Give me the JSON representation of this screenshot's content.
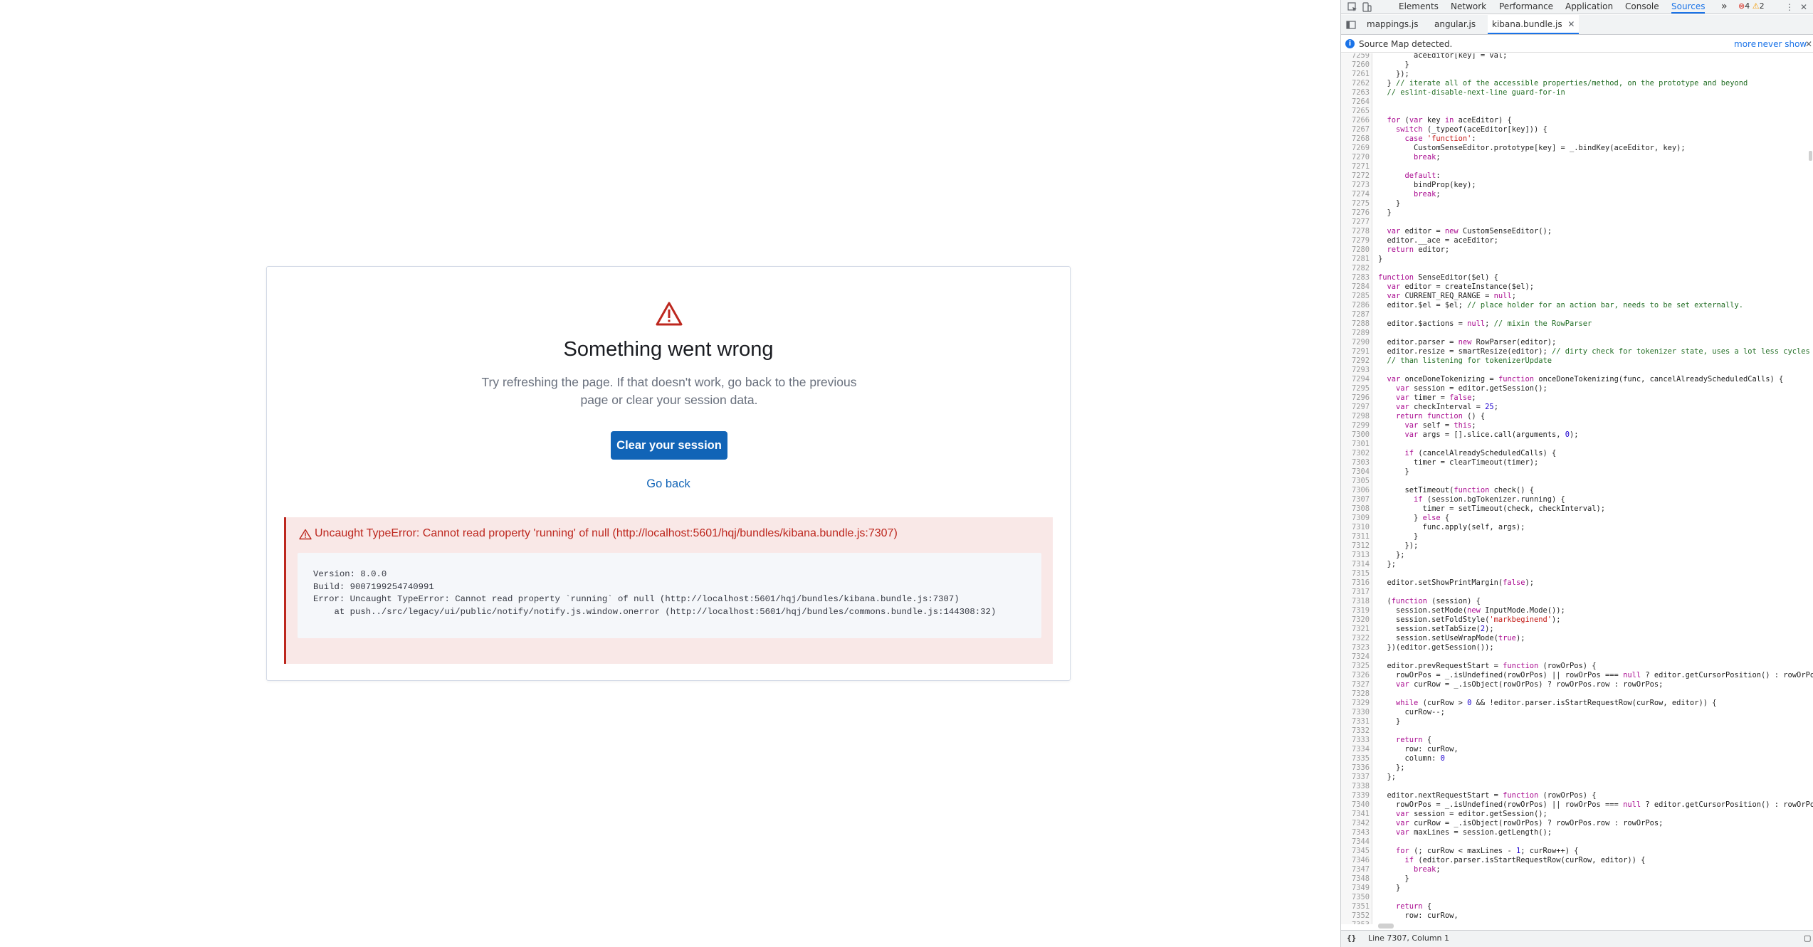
{
  "app": {
    "title": "Something went wrong",
    "body": "Try refreshing the page. If that doesn't work, go back to the previous page or clear your session data.",
    "clear_button": "Clear your session",
    "go_back": "Go back",
    "error_title": "Uncaught TypeError: Cannot read property 'running' of null (http://localhost:5601/hqj/bundles/kibana.bundle.js:7307)",
    "error_details": "Version: 8.0.0\nBuild: 9007199254740991\nError: Uncaught TypeError: Cannot read property `running` of null (http://localhost:5601/hqj/bundles/kibana.bundle.js:7307)\n    at push../src/legacy/ui/public/notify/notify.js.window.onerror (http://localhost:5601/hqj/bundles/commons.bundle.js:144308:32)"
  },
  "devtools": {
    "tabs": [
      {
        "label": "Elements",
        "active": false
      },
      {
        "label": "Network",
        "active": false
      },
      {
        "label": "Performance",
        "active": false
      },
      {
        "label": "Application",
        "active": false
      },
      {
        "label": "Console",
        "active": false
      },
      {
        "label": "Sources",
        "active": true
      }
    ],
    "more_tabs": "»",
    "error_count": "4",
    "warning_count": "2",
    "file_tabs": [
      {
        "label": "mappings.js",
        "active": false
      },
      {
        "label": "angular.js",
        "active": false
      },
      {
        "label": "kibana.bundle.js",
        "active": true
      }
    ],
    "sourcemap_text": "Source Map detected.",
    "sourcemap_more": "more",
    "sourcemap_never": "never show",
    "status": "Line 7307, Column 1",
    "code_lines": [
      {
        "n": "7259",
        "code": "        aceEditor[key] = val;"
      },
      {
        "n": "7260",
        "code": "      }"
      },
      {
        "n": "7261",
        "code": "    });"
      },
      {
        "n": "7262",
        "code": "  } // iterate all of the accessible properties/method, on the prototype and beyond"
      },
      {
        "n": "7263",
        "code": "  // eslint-disable-next-line guard-for-in"
      },
      {
        "n": "7264",
        "code": ""
      },
      {
        "n": "7265",
        "code": ""
      },
      {
        "n": "7266",
        "code": "  for (var key in aceEditor) {"
      },
      {
        "n": "7267",
        "code": "    switch (_typeof(aceEditor[key])) {"
      },
      {
        "n": "7268",
        "code": "      case 'function':"
      },
      {
        "n": "7269",
        "code": "        CustomSenseEditor.prototype[key] = _.bindKey(aceEditor, key);"
      },
      {
        "n": "7270",
        "code": "        break;"
      },
      {
        "n": "7271",
        "code": ""
      },
      {
        "n": "7272",
        "code": "      default:"
      },
      {
        "n": "7273",
        "code": "        bindProp(key);"
      },
      {
        "n": "7274",
        "code": "        break;"
      },
      {
        "n": "7275",
        "code": "    }"
      },
      {
        "n": "7276",
        "code": "  }"
      },
      {
        "n": "7277",
        "code": ""
      },
      {
        "n": "7278",
        "code": "  var editor = new CustomSenseEditor();"
      },
      {
        "n": "7279",
        "code": "  editor.__ace = aceEditor;"
      },
      {
        "n": "7280",
        "code": "  return editor;"
      },
      {
        "n": "7281",
        "code": "}"
      },
      {
        "n": "7282",
        "code": ""
      },
      {
        "n": "7283",
        "code": "function SenseEditor($el) {"
      },
      {
        "n": "7284",
        "code": "  var editor = createInstance($el);"
      },
      {
        "n": "7285",
        "code": "  var CURRENT_REQ_RANGE = null;"
      },
      {
        "n": "7286",
        "code": "  editor.$el = $el; // place holder for an action bar, needs to be set externally."
      },
      {
        "n": "7287",
        "code": ""
      },
      {
        "n": "7288",
        "code": "  editor.$actions = null; // mixin the RowParser"
      },
      {
        "n": "7289",
        "code": ""
      },
      {
        "n": "7290",
        "code": "  editor.parser = new RowParser(editor);"
      },
      {
        "n": "7291",
        "code": "  editor.resize = smartResize(editor); // dirty check for tokenizer state, uses a lot less cycles"
      },
      {
        "n": "7292",
        "code": "  // than listening for tokenizerUpdate"
      },
      {
        "n": "7293",
        "code": ""
      },
      {
        "n": "7294",
        "code": "  var onceDoneTokenizing = function onceDoneTokenizing(func, cancelAlreadyScheduledCalls) {"
      },
      {
        "n": "7295",
        "code": "    var session = editor.getSession();"
      },
      {
        "n": "7296",
        "code": "    var timer = false;"
      },
      {
        "n": "7297",
        "code": "    var checkInterval = 25;"
      },
      {
        "n": "7298",
        "code": "    return function () {"
      },
      {
        "n": "7299",
        "code": "      var self = this;"
      },
      {
        "n": "7300",
        "code": "      var args = [].slice.call(arguments, 0);"
      },
      {
        "n": "7301",
        "code": ""
      },
      {
        "n": "7302",
        "code": "      if (cancelAlreadyScheduledCalls) {"
      },
      {
        "n": "7303",
        "code": "        timer = clearTimeout(timer);"
      },
      {
        "n": "7304",
        "code": "      }"
      },
      {
        "n": "7305",
        "code": ""
      },
      {
        "n": "7306",
        "code": "      setTimeout(function check() {"
      },
      {
        "n": "7307",
        "code": "        if (session.bgTokenizer.running) {"
      },
      {
        "n": "7308",
        "code": "          timer = setTimeout(check, checkInterval);"
      },
      {
        "n": "7309",
        "code": "        } else {"
      },
      {
        "n": "7310",
        "code": "          func.apply(self, args);"
      },
      {
        "n": "7311",
        "code": "        }"
      },
      {
        "n": "7312",
        "code": "      });"
      },
      {
        "n": "7313",
        "code": "    };"
      },
      {
        "n": "7314",
        "code": "  };"
      },
      {
        "n": "7315",
        "code": ""
      },
      {
        "n": "7316",
        "code": "  editor.setShowPrintMargin(false);"
      },
      {
        "n": "7317",
        "code": ""
      },
      {
        "n": "7318",
        "code": "  (function (session) {"
      },
      {
        "n": "7319",
        "code": "    session.setMode(new InputMode.Mode());"
      },
      {
        "n": "7320",
        "code": "    session.setFoldStyle('markbeginend');"
      },
      {
        "n": "7321",
        "code": "    session.setTabSize(2);"
      },
      {
        "n": "7322",
        "code": "    session.setUseWrapMode(true);"
      },
      {
        "n": "7323",
        "code": "  })(editor.getSession());"
      },
      {
        "n": "7324",
        "code": ""
      },
      {
        "n": "7325",
        "code": "  editor.prevRequestStart = function (rowOrPos) {"
      },
      {
        "n": "7326",
        "code": "    rowOrPos = _.isUndefined(rowOrPos) || rowOrPos === null ? editor.getCursorPosition() : rowOrPos;"
      },
      {
        "n": "7327",
        "code": "    var curRow = _.isObject(rowOrPos) ? rowOrPos.row : rowOrPos;"
      },
      {
        "n": "7328",
        "code": ""
      },
      {
        "n": "7329",
        "code": "    while (curRow > 0 && !editor.parser.isStartRequestRow(curRow, editor)) {"
      },
      {
        "n": "7330",
        "code": "      curRow--;"
      },
      {
        "n": "7331",
        "code": "    }"
      },
      {
        "n": "7332",
        "code": ""
      },
      {
        "n": "7333",
        "code": "    return {"
      },
      {
        "n": "7334",
        "code": "      row: curRow,"
      },
      {
        "n": "7335",
        "code": "      column: 0"
      },
      {
        "n": "7336",
        "code": "    };"
      },
      {
        "n": "7337",
        "code": "  };"
      },
      {
        "n": "7338",
        "code": ""
      },
      {
        "n": "7339",
        "code": "  editor.nextRequestStart = function (rowOrPos) {"
      },
      {
        "n": "7340",
        "code": "    rowOrPos = _.isUndefined(rowOrPos) || rowOrPos === null ? editor.getCursorPosition() : rowOrPos;"
      },
      {
        "n": "7341",
        "code": "    var session = editor.getSession();"
      },
      {
        "n": "7342",
        "code": "    var curRow = _.isObject(rowOrPos) ? rowOrPos.row : rowOrPos;"
      },
      {
        "n": "7343",
        "code": "    var maxLines = session.getLength();"
      },
      {
        "n": "7344",
        "code": ""
      },
      {
        "n": "7345",
        "code": "    for (; curRow < maxLines - 1; curRow++) {"
      },
      {
        "n": "7346",
        "code": "      if (editor.parser.isStartRequestRow(curRow, editor)) {"
      },
      {
        "n": "7347",
        "code": "        break;"
      },
      {
        "n": "7348",
        "code": "      }"
      },
      {
        "n": "7349",
        "code": "    }"
      },
      {
        "n": "7350",
        "code": ""
      },
      {
        "n": "7351",
        "code": "    return {"
      },
      {
        "n": "7352",
        "code": "      row: curRow,"
      },
      {
        "n": "7353",
        "code": ""
      }
    ]
  }
}
